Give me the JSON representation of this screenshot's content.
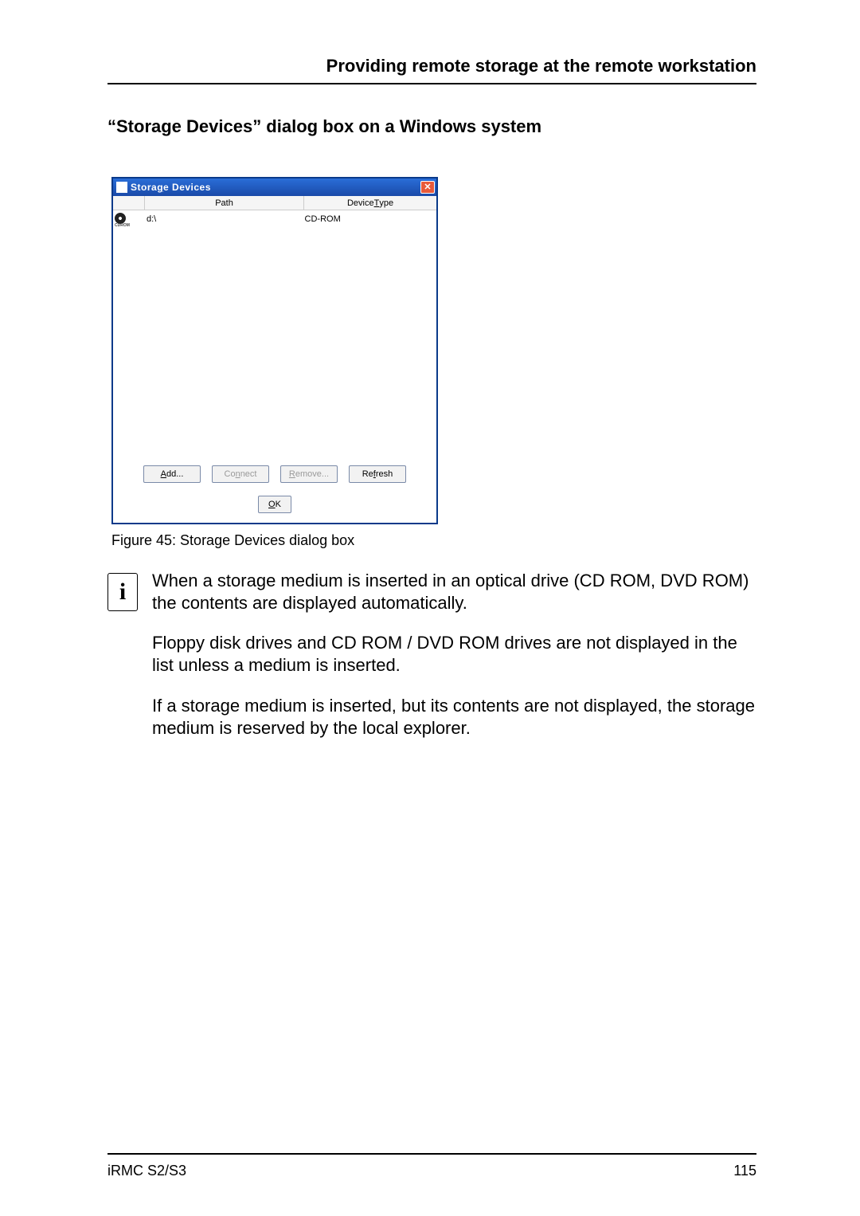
{
  "header": {
    "section_title": "Providing remote storage at the remote workstation"
  },
  "subheading": "“Storage Devices” dialog box on a Windows system",
  "dialog": {
    "title_html": "Stora<u>g</u>e Devices",
    "close_symbol": "✕",
    "columns": {
      "icon": "",
      "path_html": "Path",
      "type_html": "Device <u>T</u>ype"
    },
    "rows": [
      {
        "icon_name": "cdrom-icon",
        "icon_label": "CDROM",
        "path": "d:\\",
        "type": "CD-ROM"
      }
    ],
    "buttons": {
      "add_html": "<u>A</u>dd...",
      "connect_html": "Co<u>n</u>nect",
      "remove_html": "<u>R</u>emove...",
      "refresh_html": "Re<u>f</u>resh",
      "ok_html": "<u>O</u>K"
    }
  },
  "caption": "Figure 45: Storage Devices dialog box",
  "info": {
    "icon_char": "i",
    "paragraphs": [
      "When a storage medium is inserted in an optical drive (CD ROM, DVD ROM) the contents are displayed automatically.",
      "Floppy disk drives and CD ROM / DVD ROM drives are not displayed in the list unless a medium is inserted.",
      "If a storage medium is inserted, but its contents are not displayed, the storage medium is reserved by the local explorer."
    ]
  },
  "footer": {
    "left": "iRMC S2/S3",
    "right": "115"
  }
}
